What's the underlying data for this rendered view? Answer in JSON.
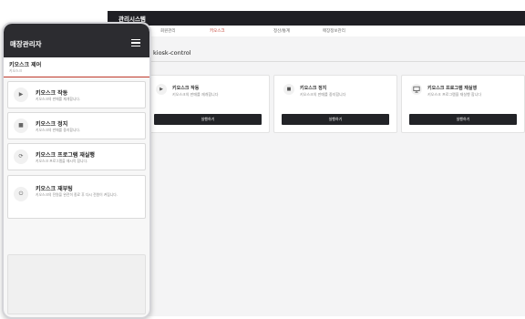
{
  "desktop": {
    "title": "관리시스템",
    "nav": [
      "회원관리",
      "키오스크",
      "정산/통계",
      "매장정보관리"
    ],
    "page_title": "kiosk-control",
    "cards": [
      {
        "icon": "play-icon",
        "title": "키오스크 작동",
        "desc": "키오스크의 판매를 재개합니다",
        "button": "실행하기"
      },
      {
        "icon": "stop-icon",
        "title": "키오스크 정지",
        "desc": "키오스크의 판매를 중지합니다",
        "button": "실행하기"
      },
      {
        "icon": "monitor-icon",
        "title": "키오스크 프로그램 재실행",
        "desc": "키오스크 프로그램을 재실행 합니다",
        "button": "실행하기"
      }
    ]
  },
  "mobile": {
    "header_title": "매장관리자",
    "section_title": "키오스크 제어",
    "section_sub": "키오스크",
    "items": [
      {
        "icon": "play-icon",
        "title": "키오스크 작동",
        "desc": "키오스크의 판매를 재개합니다."
      },
      {
        "icon": "stop-icon",
        "title": "키오스크 정지",
        "desc": "키오스크의 판매를 중지합니다."
      },
      {
        "icon": "refresh-icon",
        "title": "키오스크 프로그램 재실행",
        "desc": "키오스크 프로그램을 재시작 합니다."
      },
      {
        "icon": "power-icon",
        "title": "키오스크 재부팅",
        "desc": "키오스크의 전원을 완전히 종료 후 다시 전원이 켜집니다."
      }
    ]
  },
  "colors": {
    "header": "#2c2c30",
    "accent": "#c0392b",
    "button": "#222327"
  }
}
